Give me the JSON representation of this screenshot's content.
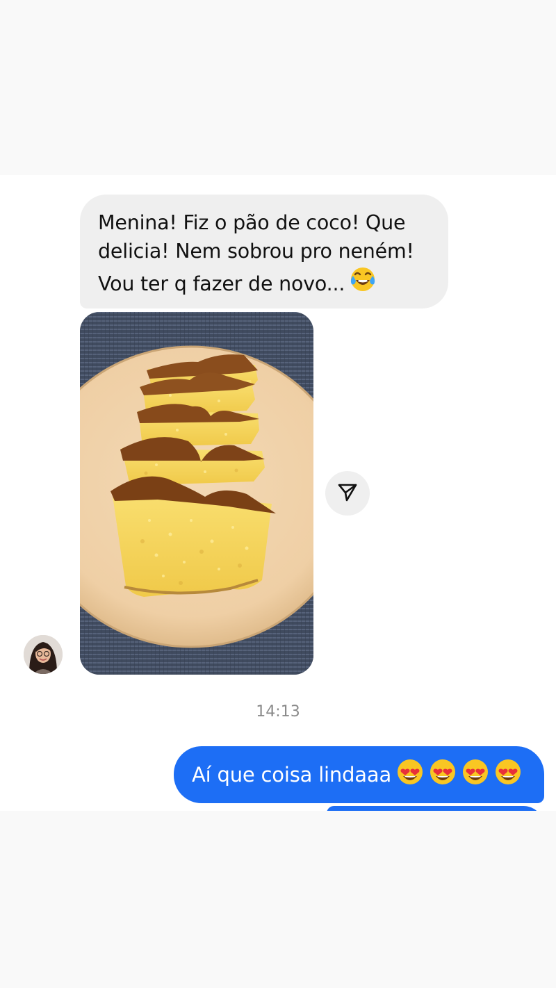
{
  "messages": {
    "incoming_text_lines": [
      "Menina! Fiz o pão de coco! Que",
      "delicia! Nem sobrou pro neném!",
      "Vou ter q fazer de novo..."
    ],
    "incoming_emoji": "face-with-tears-of-joy-emoji",
    "incoming_photo": "photo-sliced-coconut-bread-on-plate",
    "timestamp": "14:13",
    "outgoing_text": "Aí que coisa lindaaa",
    "outgoing_emojis": [
      "smiling-face-with-heart-eyes-emoji",
      "smiling-face-with-heart-eyes-emoji",
      "smiling-face-with-heart-eyes-emoji",
      "smiling-face-with-heart-eyes-emoji"
    ]
  },
  "icons": {
    "share": "paper-plane-icon",
    "avatar": "contact-avatar"
  },
  "colors": {
    "incoming_bubble": "#efefef",
    "outgoing_bubble": "#1d6ef5",
    "timestamp": "#8a8a8a",
    "background": "#ffffff"
  }
}
